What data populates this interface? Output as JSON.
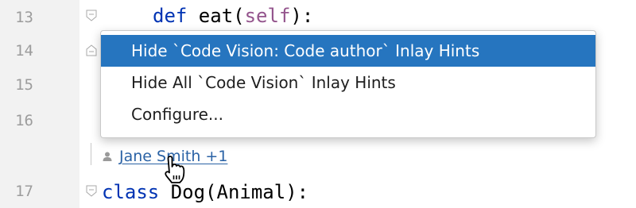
{
  "editor": {
    "lines": [
      {
        "number": "13"
      },
      {
        "number": "14"
      },
      {
        "number": "15"
      },
      {
        "number": "16"
      },
      {
        "number": "17"
      }
    ],
    "line13": {
      "kw": "def",
      "name": " eat(",
      "self": "self",
      "rest": "):"
    },
    "line17": {
      "kw": "class",
      "rest": " Dog(Animal):"
    }
  },
  "code_vision": {
    "author": "Jane Smith +1",
    "icon": "person-icon"
  },
  "context_menu": {
    "items": [
      {
        "label": "Hide `Code Vision: Code author` Inlay Hints",
        "selected": true
      },
      {
        "label": "Hide All `Code Vision` Inlay Hints",
        "selected": false
      },
      {
        "label": "Configure...",
        "selected": false
      }
    ]
  },
  "colors": {
    "selection": "#2675bf",
    "keyword": "#0033b3",
    "self": "#94558d",
    "link": "#2a62a5"
  }
}
